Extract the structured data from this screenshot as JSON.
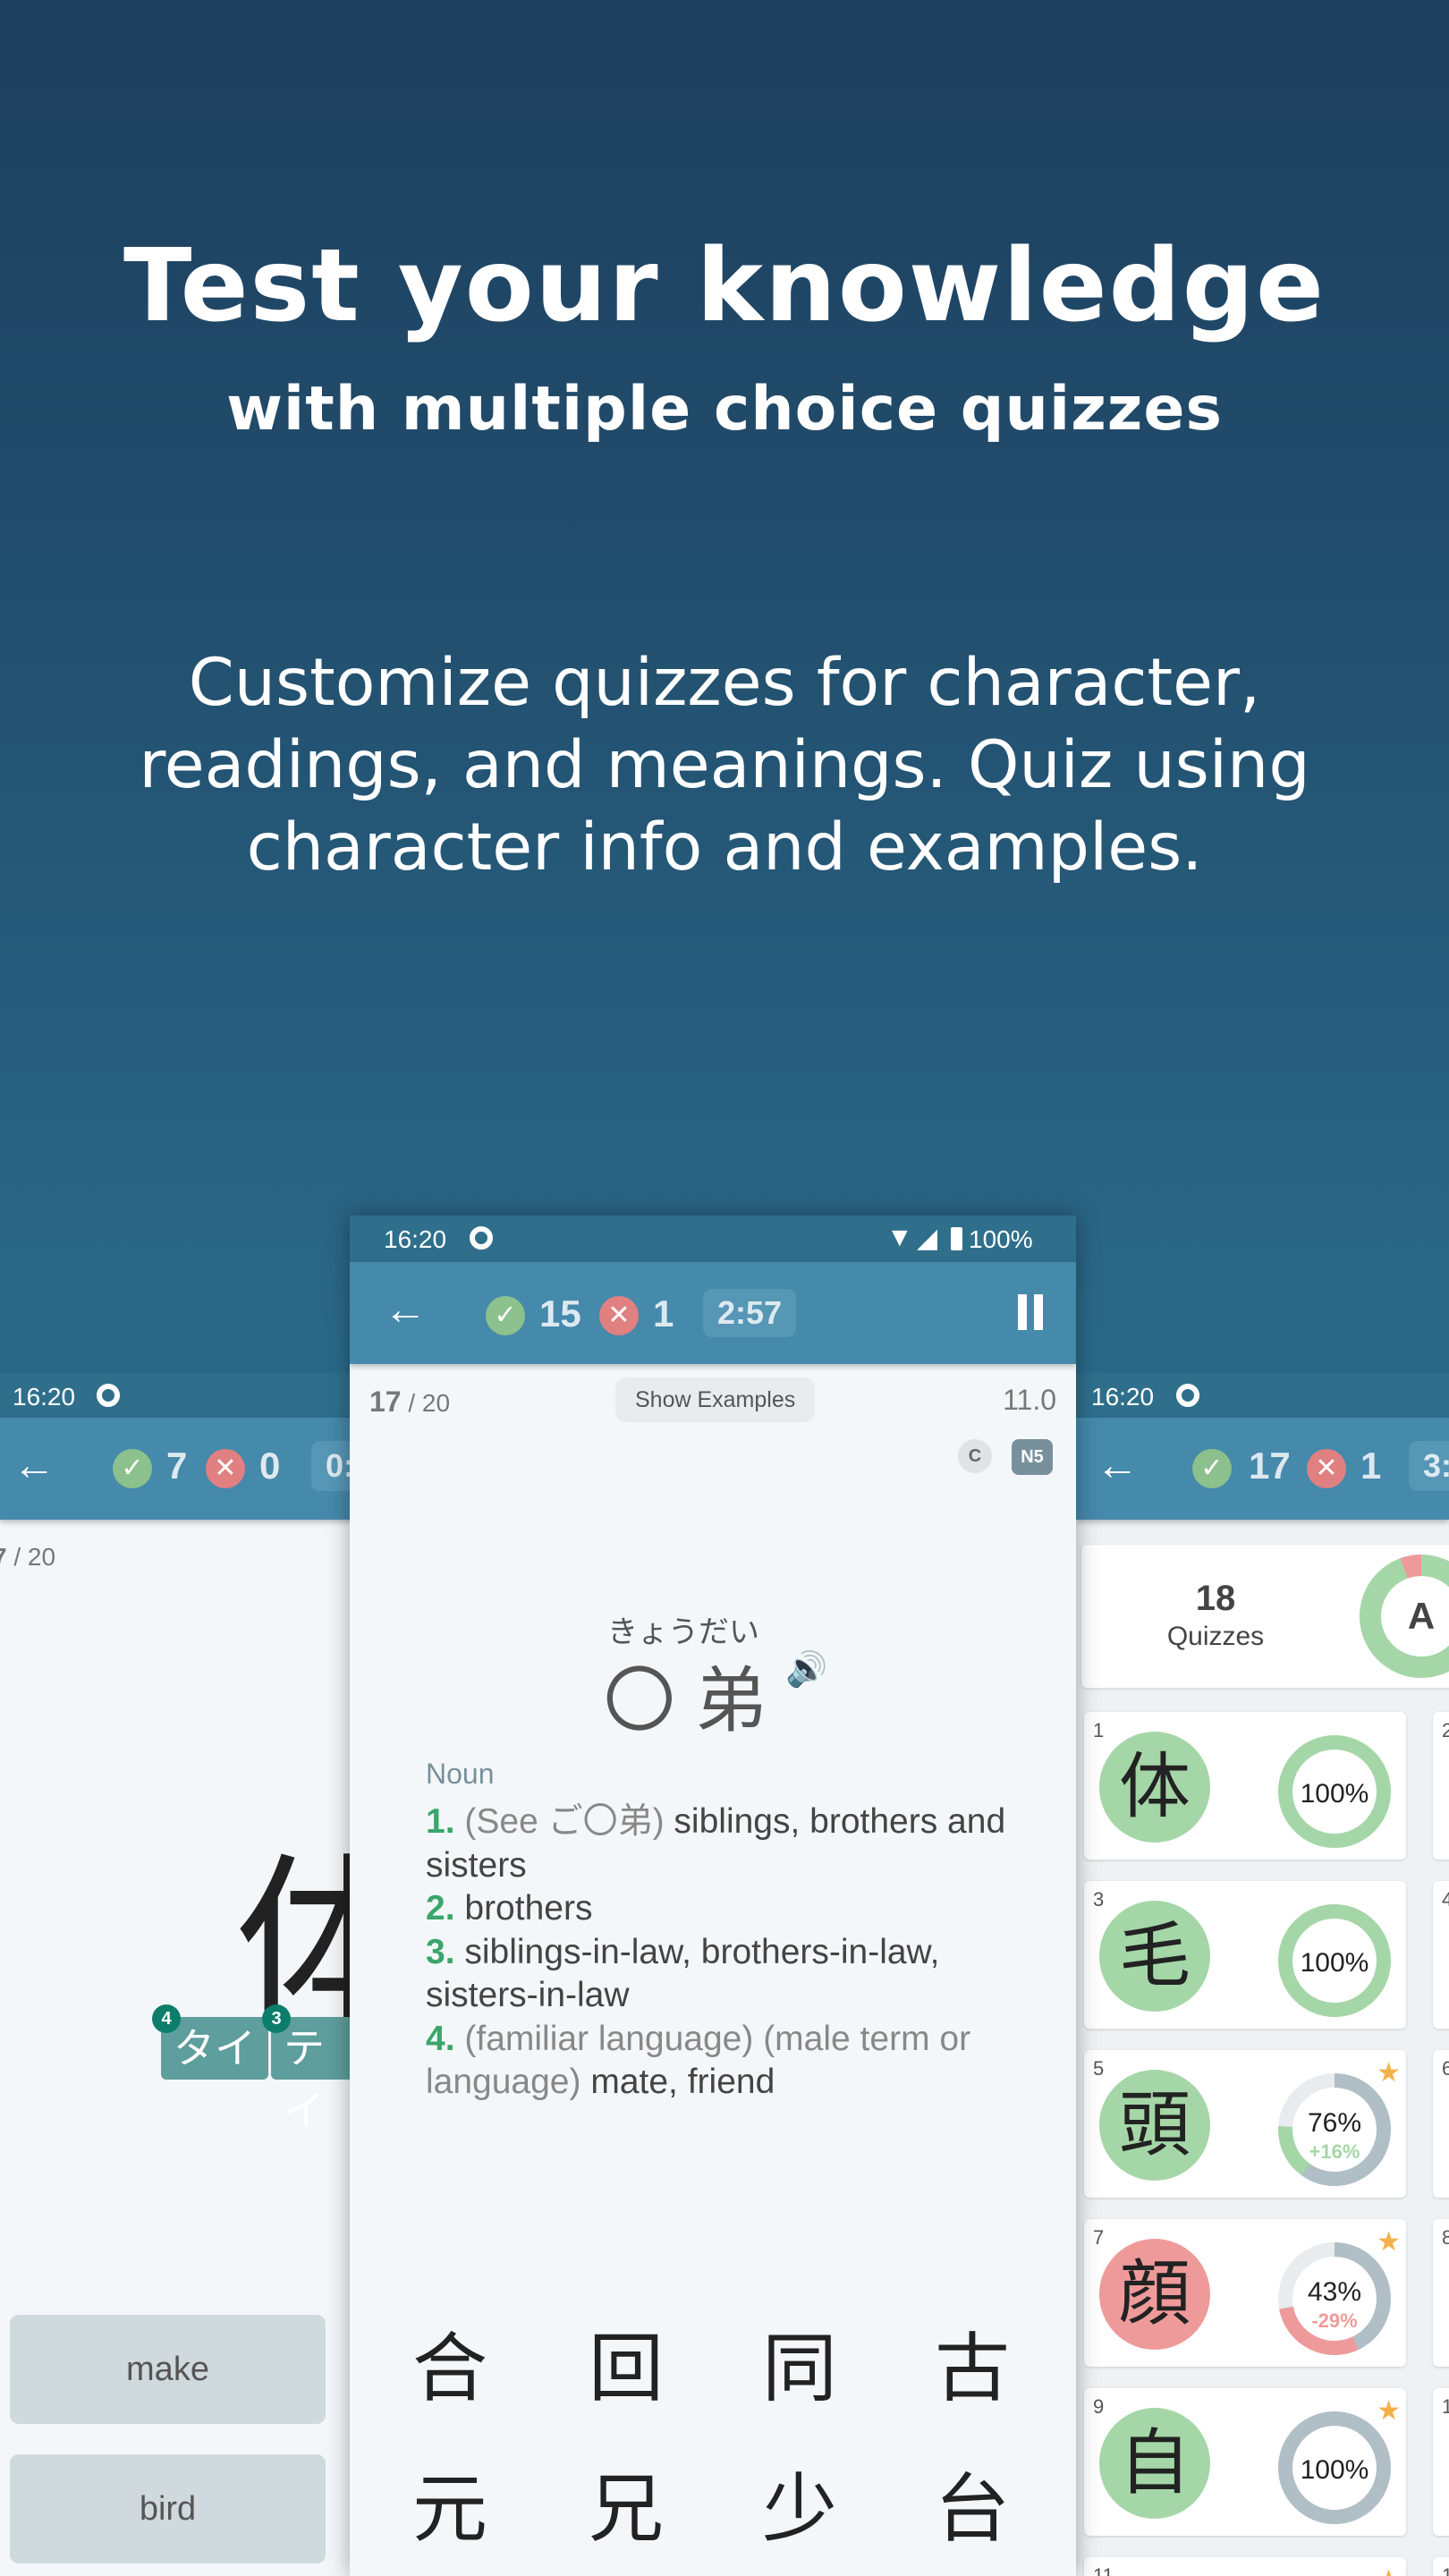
{
  "headline": {
    "title": "Test your knowledge",
    "subtitle": "with multiple choice quizzes",
    "description": "Customize quizzes for character, readings, and meanings. Quiz using character info and examples."
  },
  "colors": {
    "toolbar": "#4589ab",
    "status_bar": "#2f6f8c",
    "correct": "#8cc08c",
    "wrong": "#e08080",
    "green_bg": "#a5d6a7",
    "red_bg": "#ef9a9a",
    "star": "#f2b14a"
  },
  "left_phone": {
    "time": "16:20",
    "correct": "7",
    "wrong": "0",
    "timer": "0:",
    "progress_current": "7",
    "progress_total": "/ 20",
    "kanji": "体",
    "readings": [
      {
        "label": "タイ",
        "badge": "4"
      },
      {
        "label": "テイ",
        "badge": "3"
      }
    ],
    "answers": [
      "make",
      "bird"
    ]
  },
  "center_phone": {
    "time": "16:20",
    "battery": "100%",
    "correct": "15",
    "wrong": "1",
    "timer": "2:57",
    "progress_current": "17",
    "progress_total": "/ 20",
    "show_examples": "Show Examples",
    "score": "11.0",
    "badge_c": "C",
    "badge_level": "N5",
    "furigana": "きょうだい",
    "word": "〇 弟",
    "pos": "Noun",
    "definitions": [
      {
        "num": "1.",
        "note": "(See ご〇弟)",
        "text": "siblings, brothers and sisters"
      },
      {
        "num": "2.",
        "note": "",
        "text": "brothers"
      },
      {
        "num": "3.",
        "note": "",
        "text": "siblings-in-law, brothers-in-law, sisters-in-law"
      },
      {
        "num": "4.",
        "note": "(familiar language) (male term or language)",
        "text": "mate, friend"
      }
    ],
    "choices": [
      "合",
      "回",
      "同",
      "古",
      "元",
      "兄",
      "少",
      "台"
    ]
  },
  "right_phone": {
    "time": "16:20",
    "correct": "17",
    "wrong": "1",
    "timer": "3:",
    "quiz_count": "18",
    "quiz_label": "Quizzes",
    "grade": "A",
    "grade_wrong_fraction": 0.055,
    "cards": [
      {
        "num": "1",
        "kanji": "体",
        "state": "green",
        "pct": "100%",
        "pct_value": 100,
        "delta": "",
        "delta_value": 0,
        "ring": "green",
        "starred": false
      },
      {
        "num": "3",
        "kanji": "毛",
        "state": "green",
        "pct": "100%",
        "pct_value": 100,
        "delta": "",
        "delta_value": 0,
        "ring": "green",
        "starred": false
      },
      {
        "num": "5",
        "kanji": "頭",
        "state": "green",
        "pct": "76%",
        "pct_value": 76,
        "delta": "+16%",
        "delta_value": 16,
        "ring": "gray",
        "starred": true
      },
      {
        "num": "7",
        "kanji": "顔",
        "state": "red",
        "pct": "43%",
        "pct_value": 43,
        "delta": "-29%",
        "delta_value": -29,
        "ring": "gray",
        "starred": true
      },
      {
        "num": "9",
        "kanji": "自",
        "state": "green",
        "pct": "100%",
        "pct_value": 100,
        "delta": "",
        "delta_value": 0,
        "ring": "gray",
        "starred": true
      },
      {
        "num": "11",
        "kanji": "",
        "state": "",
        "pct": "",
        "pct_value": 0,
        "delta": "",
        "delta_value": 0,
        "ring": "",
        "starred": true
      }
    ],
    "side_numbers": [
      "2",
      "4",
      "6",
      "8",
      "1",
      "1"
    ]
  }
}
